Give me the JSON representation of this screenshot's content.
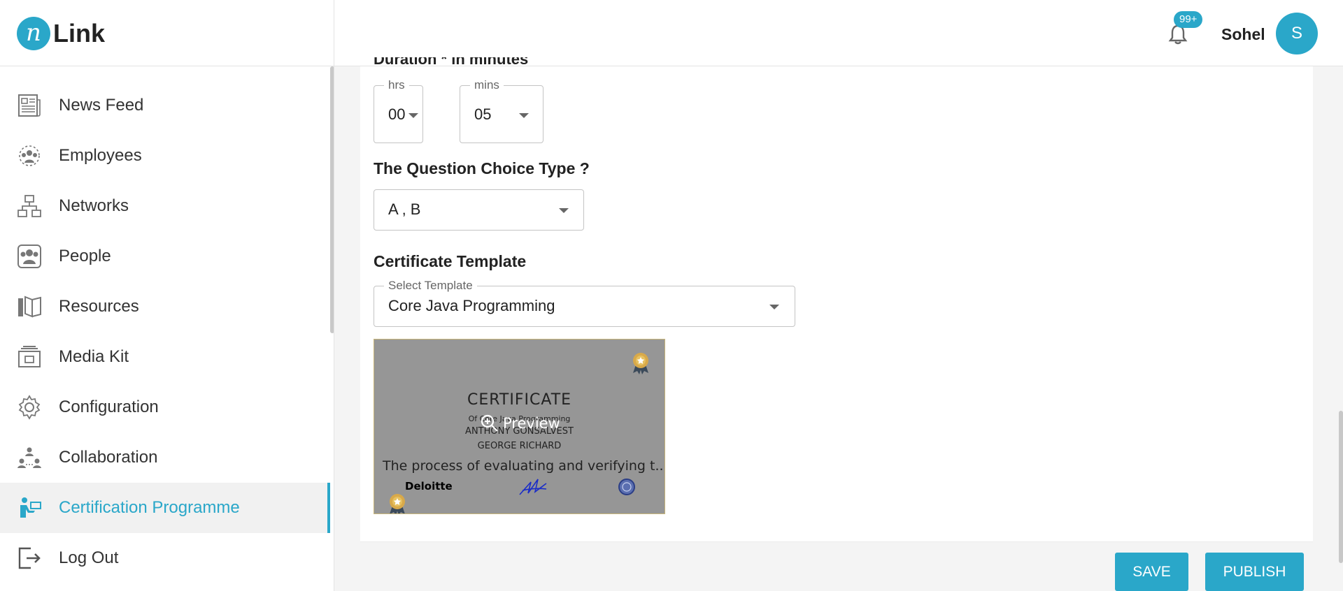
{
  "brand": {
    "logo_letter": "n",
    "name": "Link"
  },
  "header": {
    "notification_count": "99+",
    "user_name": "Sohel",
    "avatar_initial": "S"
  },
  "sidebar": {
    "items": [
      {
        "label": "News Feed",
        "icon": "news-feed-icon"
      },
      {
        "label": "Employees",
        "icon": "employees-icon"
      },
      {
        "label": "Networks",
        "icon": "networks-icon"
      },
      {
        "label": "People",
        "icon": "people-icon"
      },
      {
        "label": "Resources",
        "icon": "resources-icon"
      },
      {
        "label": "Media Kit",
        "icon": "media-kit-icon"
      },
      {
        "label": "Configuration",
        "icon": "gear-icon"
      },
      {
        "label": "Collaboration",
        "icon": "collaboration-icon"
      },
      {
        "label": "Certification Programme",
        "icon": "certification-icon",
        "active": true
      },
      {
        "label": "Log Out",
        "icon": "logout-icon"
      }
    ]
  },
  "form": {
    "duration_heading": "Duration * in minutes",
    "hrs": {
      "legend": "hrs",
      "value": "00"
    },
    "mins": {
      "legend": "mins",
      "value": "05"
    },
    "question_choice_label": "The Question Choice Type ?",
    "question_choice_value": "A , B",
    "certificate_label": "Certificate Template",
    "template": {
      "legend": "Select Template",
      "value": "Core Java Programming"
    }
  },
  "certificate": {
    "title": "CERTIFICATE",
    "of_line": "Of Core Java Programming",
    "name1": "ANTHONY GONSALVEST",
    "name2": "GEORGE RICHARD",
    "body": "The process of evaluating and verifying t...",
    "company": "Deloitte",
    "preview_label": "Preview"
  },
  "actions": {
    "save": "SAVE",
    "publish": "PUBLISH"
  },
  "colors": {
    "accent": "#2aa7c9",
    "certificate_overlay": "#969696"
  }
}
